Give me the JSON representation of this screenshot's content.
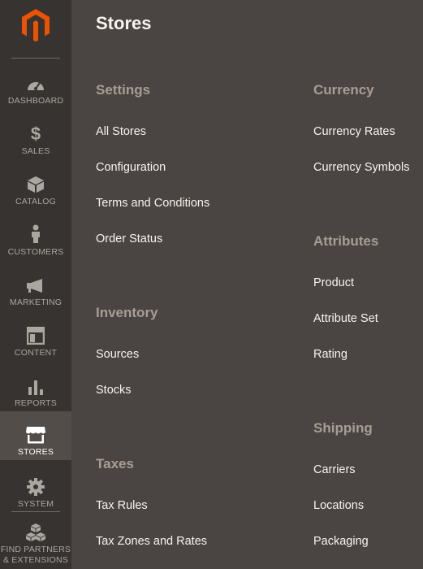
{
  "sidebar": {
    "items": [
      {
        "label": "DASHBOARD",
        "icon": "speedometer-icon"
      },
      {
        "label": "SALES",
        "icon": "dollar-icon"
      },
      {
        "label": "CATALOG",
        "icon": "box-icon"
      },
      {
        "label": "CUSTOMERS",
        "icon": "person-icon"
      },
      {
        "label": "MARKETING",
        "icon": "megaphone-icon"
      },
      {
        "label": "CONTENT",
        "icon": "layout-icon"
      },
      {
        "label": "REPORTS",
        "icon": "bar-chart-icon"
      },
      {
        "label": "STORES",
        "icon": "storefront-icon",
        "active": true
      },
      {
        "label": "SYSTEM",
        "icon": "gear-icon"
      },
      {
        "label": "FIND PARTNERS\n& EXTENSIONS",
        "icon": "cubes-icon"
      }
    ]
  },
  "panel": {
    "title": "Stores",
    "sections": {
      "settings": {
        "title": "Settings",
        "links": [
          "All Stores",
          "Configuration",
          "Terms and Conditions",
          "Order Status"
        ]
      },
      "inventory": {
        "title": "Inventory",
        "links": [
          "Sources",
          "Stocks"
        ]
      },
      "taxes": {
        "title": "Taxes",
        "links": [
          "Tax Rules",
          "Tax Zones and Rates"
        ]
      },
      "currency": {
        "title": "Currency",
        "links": [
          "Currency Rates",
          "Currency Symbols"
        ]
      },
      "attributes": {
        "title": "Attributes",
        "links": [
          "Product",
          "Attribute Set",
          "Rating"
        ]
      },
      "shipping": {
        "title": "Shipping",
        "links": [
          "Carriers",
          "Locations",
          "Packaging"
        ]
      }
    }
  },
  "colors": {
    "brand": "#eb5202",
    "sidebar_bg": "#373330",
    "panel_bg": "#4a4542",
    "active_bg": "#524d49",
    "section_title": "#a79d95"
  }
}
